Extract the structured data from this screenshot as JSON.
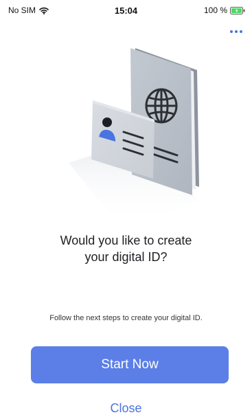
{
  "status_bar": {
    "carrier": "No SIM",
    "time": "15:04",
    "battery": "100 %",
    "wifi_icon": "wifi-icon",
    "battery_icon": "battery-charging-icon"
  },
  "menu": {
    "more_icon": "more-dots-icon",
    "accent_color": "#4a74e0"
  },
  "illustration": {
    "name": "passport-and-id-card-illustration"
  },
  "content": {
    "heading_line1": "Would you like to create",
    "heading_line2": "your digital ID?",
    "instruction": "Follow the next steps to create your digital ID."
  },
  "actions": {
    "start_label": "Start Now",
    "close_label": "Close",
    "button_color": "#5b7fe6"
  }
}
